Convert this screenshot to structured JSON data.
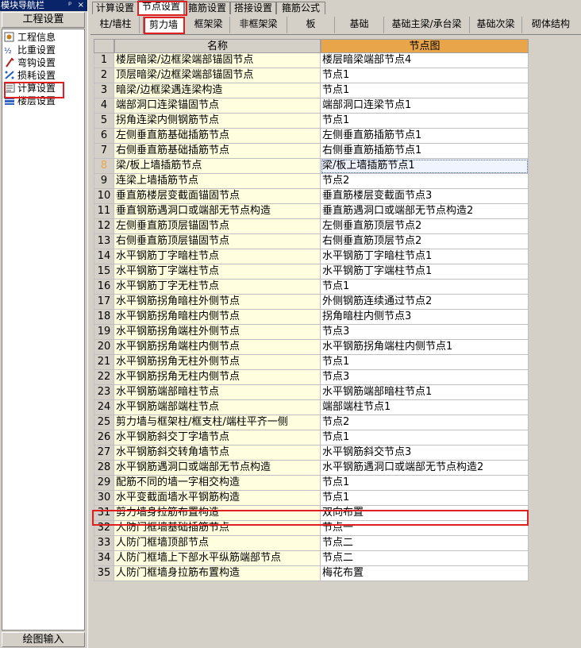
{
  "nav": {
    "title": "模块导航栏",
    "title_icons": "ᵖ ×",
    "group": "工程设置",
    "items": [
      {
        "label": "工程信息",
        "icon": "info-icon"
      },
      {
        "label": "比重设置",
        "icon": "ratio-icon"
      },
      {
        "label": "弯钩设置",
        "icon": "hook-icon"
      },
      {
        "label": "损耗设置",
        "icon": "loss-icon"
      },
      {
        "label": "计算设置",
        "icon": "calc-icon"
      },
      {
        "label": "楼层设置",
        "icon": "floor-icon"
      }
    ],
    "bottom": "绘图输入"
  },
  "main_tabs": [
    "计算设置",
    "节点设置",
    "箍筋设置",
    "搭接设置",
    "箍筋公式"
  ],
  "active_main_tab": 1,
  "sub_tabs": [
    "柱/墙柱",
    "剪力墙",
    "框架梁",
    "非框架梁",
    "板",
    "基础",
    "基础主梁/承台梁",
    "基础次梁",
    "砌体结构"
  ],
  "active_sub_tab": 1,
  "grid": {
    "col_name": "名称",
    "col_node": "节点图",
    "selected_row": 8,
    "rows": [
      {
        "idx": "1",
        "name": "楼层暗梁/边框梁端部锚固节点",
        "node": "楼层暗梁端部节点4"
      },
      {
        "idx": "2",
        "name": "顶层暗梁/边框梁端部锚固节点",
        "node": "节点1"
      },
      {
        "idx": "3",
        "name": "暗梁/边框梁遇连梁构造",
        "node": "节点1"
      },
      {
        "idx": "4",
        "name": "端部洞口连梁锚固节点",
        "node": "端部洞口连梁节点1"
      },
      {
        "idx": "5",
        "name": "拐角连梁内侧钢筋节点",
        "node": "节点1"
      },
      {
        "idx": "6",
        "name": "左侧垂直筋基础插筋节点",
        "node": "左侧垂直筋插筋节点1"
      },
      {
        "idx": "7",
        "name": "右侧垂直筋基础插筋节点",
        "node": "右侧垂直筋插筋节点1"
      },
      {
        "idx": "8",
        "name": "梁/板上墙插筋节点",
        "node": "梁/板上墙插筋节点1"
      },
      {
        "idx": "9",
        "name": "连梁上墙插筋节点",
        "node": "节点2"
      },
      {
        "idx": "10",
        "name": "垂直筋楼层变截面锚固节点",
        "node": "垂直筋楼层变截面节点3"
      },
      {
        "idx": "11",
        "name": "垂直钢筋遇洞口或端部无节点构造",
        "node": "垂直筋遇洞口或端部无节点构造2"
      },
      {
        "idx": "12",
        "name": "左侧垂直筋顶层锚固节点",
        "node": "左侧垂直筋顶层节点2"
      },
      {
        "idx": "13",
        "name": "右侧垂直筋顶层锚固节点",
        "node": "右侧垂直筋顶层节点2"
      },
      {
        "idx": "14",
        "name": "水平钢筋丁字暗柱节点",
        "node": "水平钢筋丁字暗柱节点1"
      },
      {
        "idx": "15",
        "name": "水平钢筋丁字端柱节点",
        "node": "水平钢筋丁字端柱节点1"
      },
      {
        "idx": "16",
        "name": "水平钢筋丁字无柱节点",
        "node": "节点1"
      },
      {
        "idx": "17",
        "name": "水平钢筋拐角暗柱外侧节点",
        "node": "外侧钢筋连续通过节点2"
      },
      {
        "idx": "18",
        "name": "水平钢筋拐角暗柱内侧节点",
        "node": "拐角暗柱内侧节点3"
      },
      {
        "idx": "19",
        "name": "水平钢筋拐角端柱外侧节点",
        "node": "节点3"
      },
      {
        "idx": "20",
        "name": "水平钢筋拐角端柱内侧节点",
        "node": "水平钢筋拐角端柱内侧节点1"
      },
      {
        "idx": "21",
        "name": "水平钢筋拐角无柱外侧节点",
        "node": "节点1"
      },
      {
        "idx": "22",
        "name": "水平钢筋拐角无柱内侧节点",
        "node": "节点3"
      },
      {
        "idx": "23",
        "name": "水平钢筋端部暗柱节点",
        "node": "水平钢筋端部暗柱节点1"
      },
      {
        "idx": "24",
        "name": "水平钢筋端部端柱节点",
        "node": "端部端柱节点1"
      },
      {
        "idx": "25",
        "name": "剪力墙与框架柱/框支柱/端柱平齐一侧",
        "node": "节点2"
      },
      {
        "idx": "26",
        "name": "水平钢筋斜交丁字墙节点",
        "node": "节点1"
      },
      {
        "idx": "27",
        "name": "水平钢筋斜交转角墙节点",
        "node": "水平钢筋斜交节点3"
      },
      {
        "idx": "28",
        "name": "水平钢筋遇洞口或端部无节点构造",
        "node": "水平钢筋遇洞口或端部无节点构造2"
      },
      {
        "idx": "29",
        "name": "配筋不同的墙一字相交构造",
        "node": "节点1"
      },
      {
        "idx": "30",
        "name": "水平变截面墙水平钢筋构造",
        "node": "节点1"
      },
      {
        "idx": "31",
        "name": "剪力墙身拉筋布置构造",
        "node": "双向布置"
      },
      {
        "idx": "32",
        "name": "人防门框墙基础插筋节点",
        "node": "节点一"
      },
      {
        "idx": "33",
        "name": "人防门框墙顶部节点",
        "node": "节点二"
      },
      {
        "idx": "34",
        "name": "人防门框墙上下部水平纵筋端部节点",
        "node": "节点二"
      },
      {
        "idx": "35",
        "name": "人防门框墙身拉筋布置构造",
        "node": "梅花布置"
      }
    ]
  },
  "colors": {
    "highlight": "#e02020",
    "header_accent": "#e8a54a",
    "name_bg": "#ffffe0",
    "title_bar": "#0a246a"
  }
}
